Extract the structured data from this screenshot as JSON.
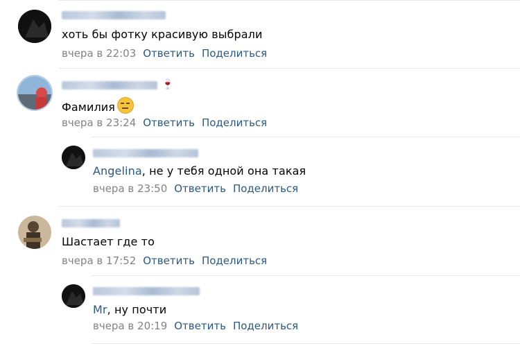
{
  "comments": [
    {
      "text": "хоть бы фотку красивую выбрали",
      "time": "вчера в 22:03",
      "reply_label": "Ответить",
      "share_label": "Поделиться",
      "avatar_color": "#111111"
    },
    {
      "author_suffix": "🍷",
      "text": "Фамилия",
      "emoji": "face-with-rolling-eyes-emoji",
      "time": "вчера в 23:24",
      "reply_label": "Ответить",
      "share_label": "Поделиться",
      "avatar_color": "#7aa6cc"
    },
    {
      "mention": "Angelina",
      "text": ", не у тебя одной она такая",
      "time": "вчера в 23:50",
      "reply_label": "Ответить",
      "share_label": "Поделиться",
      "avatar_color": "#111111"
    },
    {
      "text": "Шастает где то",
      "time": "вчера в 17:52",
      "reply_label": "Ответить",
      "share_label": "Поделиться",
      "avatar_color": "#6b5642"
    },
    {
      "mention": "Mr",
      "text": ", ну почти",
      "time": "вчера в 20:19",
      "reply_label": "Ответить",
      "share_label": "Поделиться",
      "avatar_color": "#111111"
    }
  ],
  "colors": {
    "link": "#2a5885",
    "meta": "#828282",
    "divider": "#e7e8ec"
  }
}
